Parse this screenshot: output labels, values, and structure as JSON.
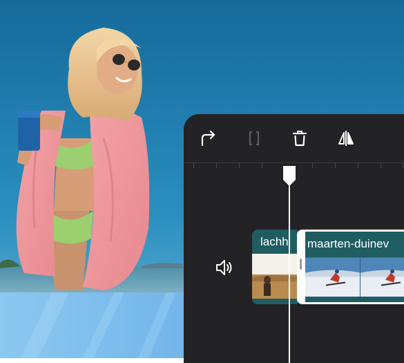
{
  "toolbar": {
    "tools": [
      {
        "icon": "redo-icon",
        "enabled": true
      },
      {
        "icon": "split-icon",
        "enabled": false
      },
      {
        "icon": "trash-icon",
        "enabled": true
      },
      {
        "icon": "flip-icon",
        "enabled": true
      }
    ]
  },
  "timeline": {
    "audio_icon": "speaker-icon",
    "clips": [
      {
        "title": "lachh"
      },
      {
        "title": "maarten-duinev"
      }
    ]
  },
  "colors": {
    "panel": "#232326",
    "clip_header": "#1f5d62",
    "sky": "#1e7fb0"
  }
}
